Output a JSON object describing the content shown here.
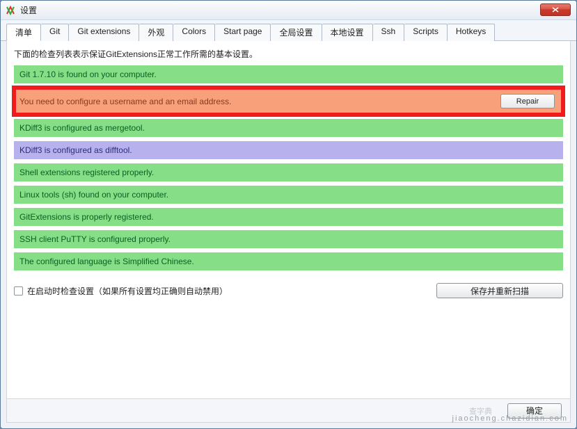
{
  "window": {
    "title": "设置"
  },
  "tabs": [
    {
      "label": "清单",
      "active": true
    },
    {
      "label": "Git"
    },
    {
      "label": "Git extensions"
    },
    {
      "label": "外观"
    },
    {
      "label": "Colors"
    },
    {
      "label": "Start page"
    },
    {
      "label": "全局设置"
    },
    {
      "label": "本地设置"
    },
    {
      "label": "Ssh"
    },
    {
      "label": "Scripts"
    },
    {
      "label": "Hotkeys"
    }
  ],
  "checklist": {
    "intro": "下面的检查列表表示保证GitExtensions正常工作所需的基本设置。",
    "rows": [
      {
        "text": "Git 1.7.10 is found on your computer.",
        "status": "green"
      },
      {
        "text": "You need to configure a username and an email address.",
        "status": "orange",
        "highlighted": true,
        "repair_label": "Repair"
      },
      {
        "text": "KDiff3 is configured as mergetool.",
        "status": "green"
      },
      {
        "text": "KDiff3 is configured as difftool.",
        "status": "purple"
      },
      {
        "text": "Shell extensions registered properly.",
        "status": "green"
      },
      {
        "text": "Linux tools (sh) found on your computer.",
        "status": "green"
      },
      {
        "text": "GitExtensions is properly registered.",
        "status": "green"
      },
      {
        "text": "SSH client PuTTY is configured properly.",
        "status": "green"
      },
      {
        "text": "The configured language is Simplified Chinese.",
        "status": "green"
      }
    ],
    "footer": {
      "checkbox_label": "在启动时检查设置（如果所有设置均正确则自动禁用）",
      "save_label": "保存并重新扫描"
    }
  },
  "bottom": {
    "watermark_left": "查字典",
    "watermark_right": "jiaocheng.chazidian.com",
    "ok_label": "确定"
  }
}
